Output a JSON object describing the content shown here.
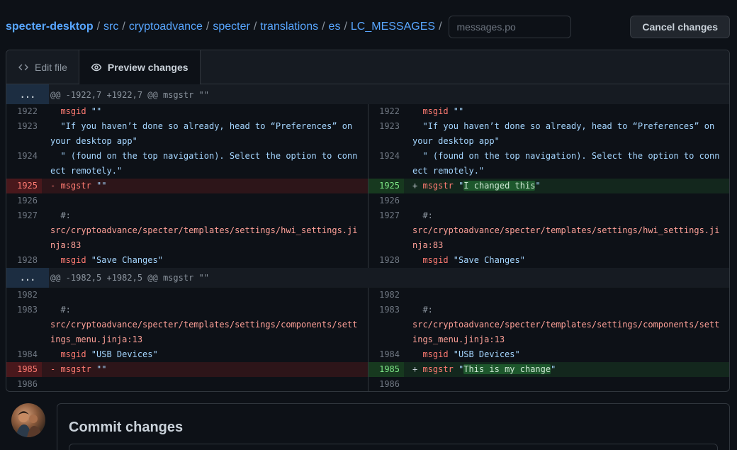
{
  "breadcrumb": {
    "items": [
      "specter-desktop",
      "src",
      "cryptoadvance",
      "specter",
      "translations",
      "es",
      "LC_MESSAGES"
    ],
    "separator": "/",
    "filename_placeholder": "messages.po"
  },
  "header": {
    "cancel_label": "Cancel changes"
  },
  "tabs": {
    "edit": "Edit file",
    "preview": "Preview changes"
  },
  "diff": {
    "expand_label": "...",
    "hunk1": "@@ -1922,7 +1922,7 @@ msgstr \"\"",
    "hunk2": "@@ -1982,5 +1982,5 @@ msgstr \"\"",
    "rows1": [
      {
        "n": "1922",
        "kw": "msgid",
        "text": " \"\""
      },
      {
        "n": "1923",
        "text": "\"If you haven’t done so already, head to “Preferences” on your desktop app\""
      },
      {
        "n": "1924",
        "text": "\" (found on the top navigation). Select the option to connect remotely.\""
      },
      {
        "n": "1925",
        "left_sign": "-",
        "left_kw": "msgstr",
        "left_text": " \"\"",
        "right_sign": "+",
        "right_kw": "msgstr",
        "right_pre": " \"",
        "right_hl": "I changed this",
        "right_post": "\""
      },
      {
        "n": "1926"
      },
      {
        "n": "1927",
        "comment": "#:",
        "path": "src/cryptoadvance/specter/templates/settings/hwi_settings.jinja:83"
      },
      {
        "n": "1928",
        "kw": "msgid",
        "text": " \"Save Changes\""
      }
    ],
    "rows2": [
      {
        "n": "1982"
      },
      {
        "n": "1983",
        "comment": "#:",
        "path": "src/cryptoadvance/specter/templates/settings/components/settings_menu.jinja:13"
      },
      {
        "n": "1984",
        "kw": "msgid",
        "text": " \"USB Devices\""
      },
      {
        "n": "1985",
        "left_sign": "-",
        "left_kw": "msgstr",
        "left_text": " \"\"",
        "right_sign": "+",
        "right_kw": "msgstr",
        "right_pre": " \"",
        "right_hl": "This is my change",
        "right_post": "\""
      },
      {
        "n": "1986"
      }
    ]
  },
  "commit": {
    "title": "Commit changes"
  },
  "colors": {
    "link": "#58a6ff",
    "deletion": "#ff7b72",
    "addition": "#7ee787",
    "background": "#0d1117"
  }
}
